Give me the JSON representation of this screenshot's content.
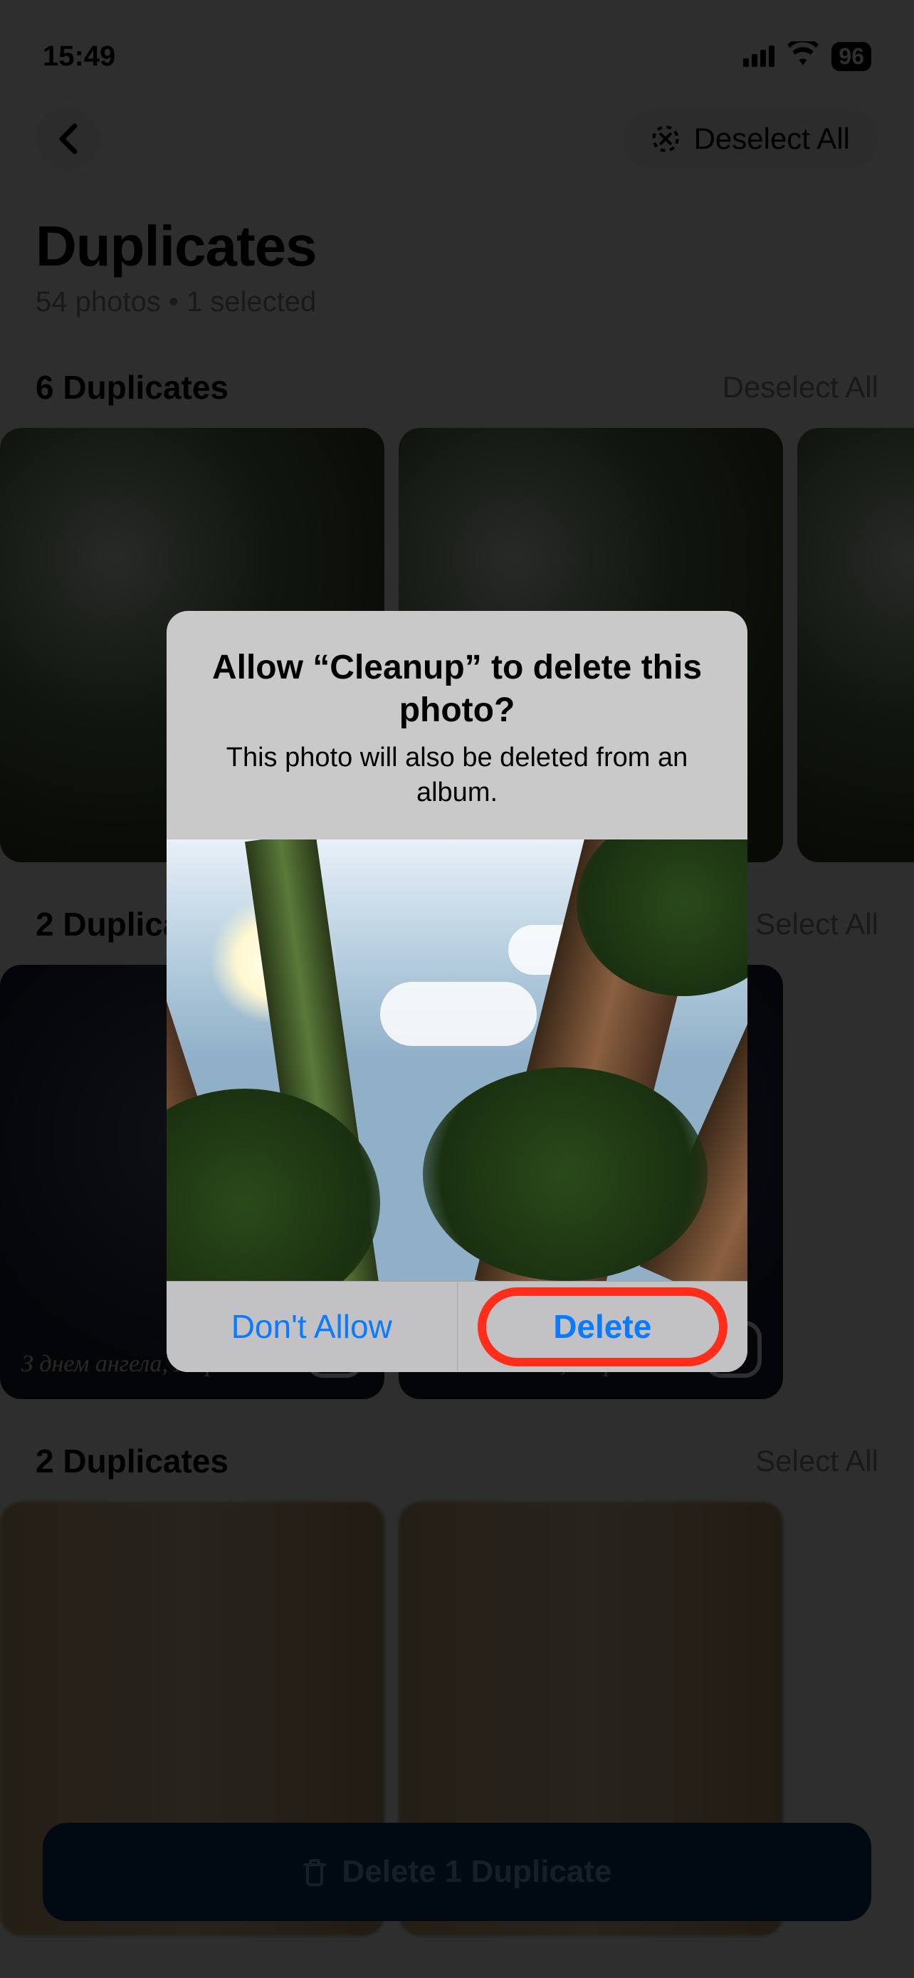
{
  "status": {
    "time": "15:49",
    "battery": "96"
  },
  "nav": {
    "deselect_all": "Deselect All"
  },
  "header": {
    "title": "Duplicates",
    "subtitle": "54 photos • 1 selected"
  },
  "sections": [
    {
      "title": "6 Duplicates",
      "action": "Deselect All",
      "thumb_caption": ""
    },
    {
      "title": "2 Duplicates",
      "action": "Select All",
      "thumb_caption": "З днем ангела, Марія!"
    },
    {
      "title": "2 Duplicates",
      "action": "Select All",
      "thumb_caption": ""
    }
  ],
  "cta": {
    "label": "Delete 1 Duplicate"
  },
  "alert": {
    "title": "Allow “Cleanup” to delete this photo?",
    "message": "This photo will also be deleted from an album.",
    "dont_allow": "Don't Allow",
    "delete": "Delete"
  }
}
